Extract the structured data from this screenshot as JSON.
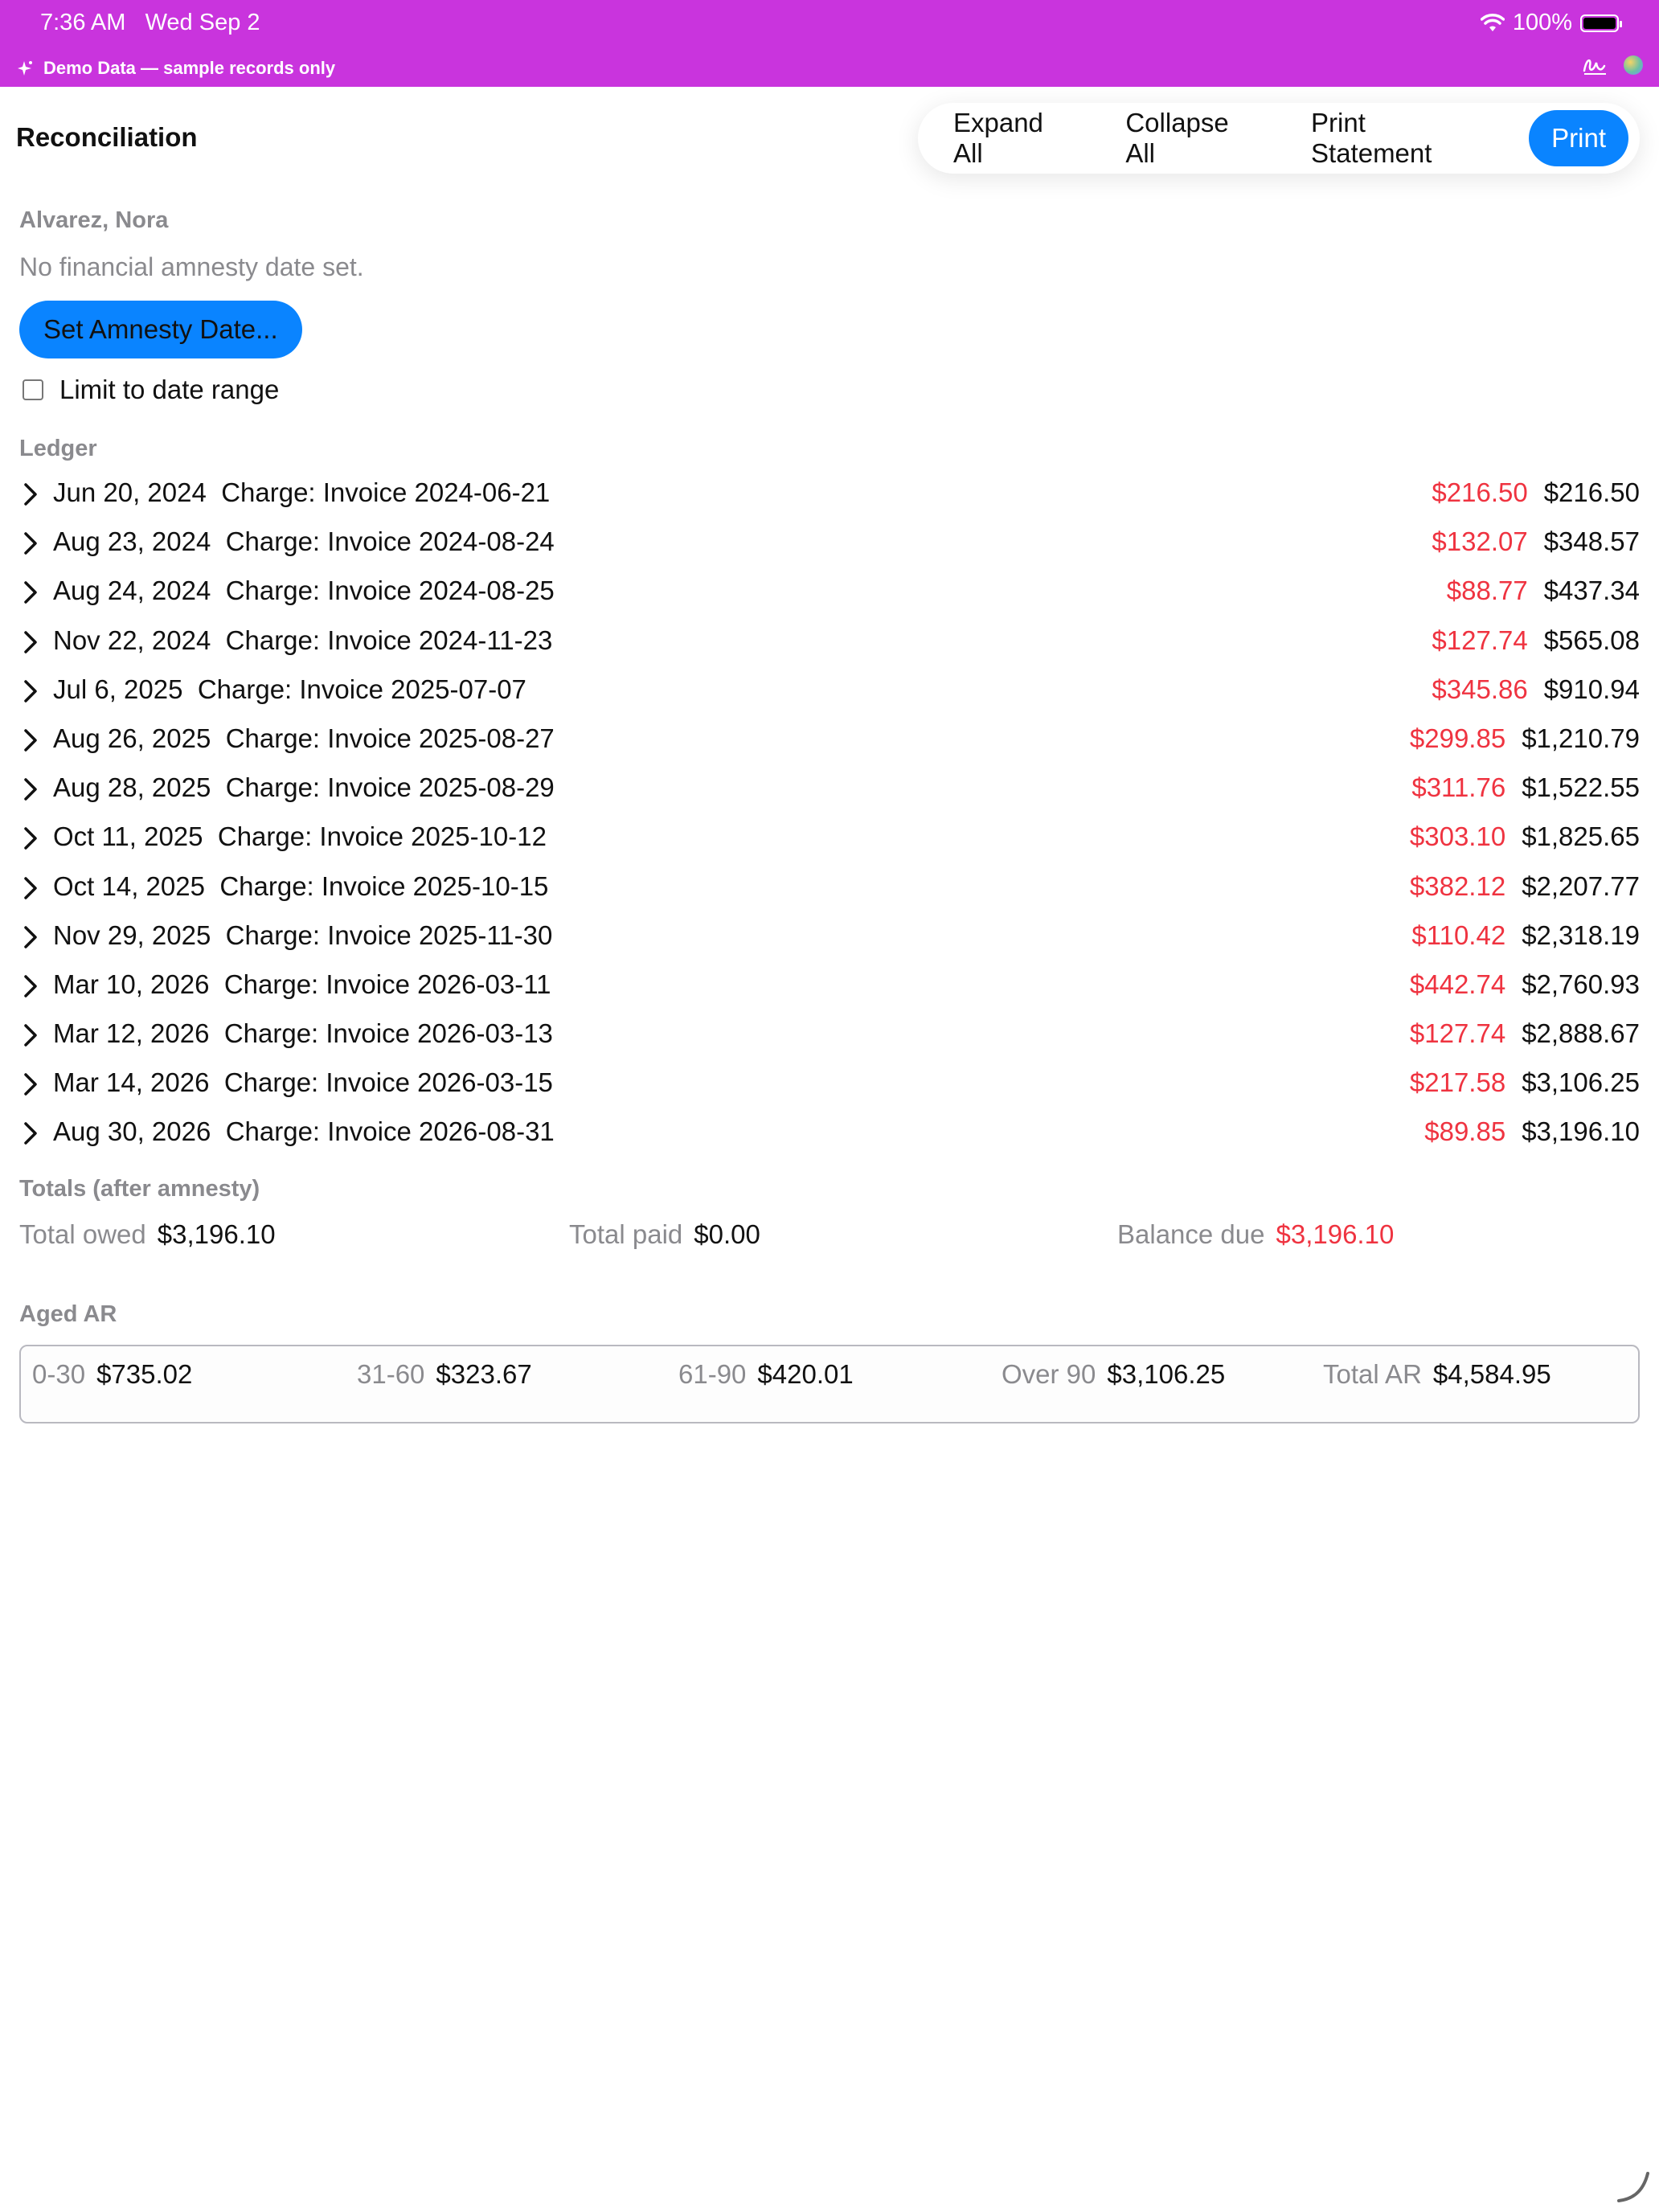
{
  "status_bar": {
    "time": "7:36 AM",
    "date": "Wed Sep 2",
    "battery": "100%",
    "demo_banner": "Demo Data — sample records only",
    "color": "#c934dd"
  },
  "header": {
    "title": "Reconciliation",
    "toolbar": {
      "expand_all": "Expand All",
      "collapse_all": "Collapse All",
      "print_statement": "Print Statement",
      "print": "Print"
    }
  },
  "patient": {
    "name": "Alvarez, Nora",
    "amnesty_status": "No financial amnesty date set.",
    "set_amnesty_label": "Set Amnesty Date...",
    "limit_label": "Limit to date range",
    "limit_checked": false
  },
  "ledger": {
    "label": "Ledger",
    "rows": [
      {
        "date": "Jun 20, 2024",
        "desc": "Charge: Invoice 2024-06-21",
        "amount": "$216.50",
        "running": "$216.50"
      },
      {
        "date": "Aug 23, 2024",
        "desc": "Charge: Invoice 2024-08-24",
        "amount": "$132.07",
        "running": "$348.57"
      },
      {
        "date": "Aug 24, 2024",
        "desc": "Charge: Invoice 2024-08-25",
        "amount": "$88.77",
        "running": "$437.34"
      },
      {
        "date": "Nov 22, 2024",
        "desc": "Charge: Invoice 2024-11-23",
        "amount": "$127.74",
        "running": "$565.08"
      },
      {
        "date": "Jul 6, 2025",
        "desc": "Charge: Invoice 2025-07-07",
        "amount": "$345.86",
        "running": "$910.94"
      },
      {
        "date": "Aug 26, 2025",
        "desc": "Charge: Invoice 2025-08-27",
        "amount": "$299.85",
        "running": "$1,210.79"
      },
      {
        "date": "Aug 28, 2025",
        "desc": "Charge: Invoice 2025-08-29",
        "amount": "$311.76",
        "running": "$1,522.55"
      },
      {
        "date": "Oct 11, 2025",
        "desc": "Charge: Invoice 2025-10-12",
        "amount": "$303.10",
        "running": "$1,825.65"
      },
      {
        "date": "Oct 14, 2025",
        "desc": "Charge: Invoice 2025-10-15",
        "amount": "$382.12",
        "running": "$2,207.77"
      },
      {
        "date": "Nov 29, 2025",
        "desc": "Charge: Invoice 2025-11-30",
        "amount": "$110.42",
        "running": "$2,318.19"
      },
      {
        "date": "Mar 10, 2026",
        "desc": "Charge: Invoice 2026-03-11",
        "amount": "$442.74",
        "running": "$2,760.93"
      },
      {
        "date": "Mar 12, 2026",
        "desc": "Charge: Invoice 2026-03-13",
        "amount": "$127.74",
        "running": "$2,888.67"
      },
      {
        "date": "Mar 14, 2026",
        "desc": "Charge: Invoice 2026-03-15",
        "amount": "$217.58",
        "running": "$3,106.25"
      },
      {
        "date": "Aug 30, 2026",
        "desc": "Charge: Invoice 2026-08-31",
        "amount": "$89.85",
        "running": "$3,196.10"
      }
    ]
  },
  "totals": {
    "label": "Totals (after amnesty)",
    "total_owed_label": "Total owed",
    "total_owed": "$3,196.10",
    "total_paid_label": "Total paid",
    "total_paid": "$0.00",
    "balance_due_label": "Balance due",
    "balance_due": "$3,196.10"
  },
  "aged_ar": {
    "label": "Aged AR",
    "buckets": [
      {
        "label": "0-30",
        "value": "$735.02"
      },
      {
        "label": "31-60",
        "value": "$323.67"
      },
      {
        "label": "61-90",
        "value": "$420.01"
      },
      {
        "label": "Over 90",
        "value": "$3,106.25"
      },
      {
        "label": "Total AR",
        "value": "$4,584.95"
      }
    ]
  },
  "colors": {
    "accent": "#0a84ff",
    "negative": "#ef3340",
    "muted": "#8a8a8e"
  }
}
